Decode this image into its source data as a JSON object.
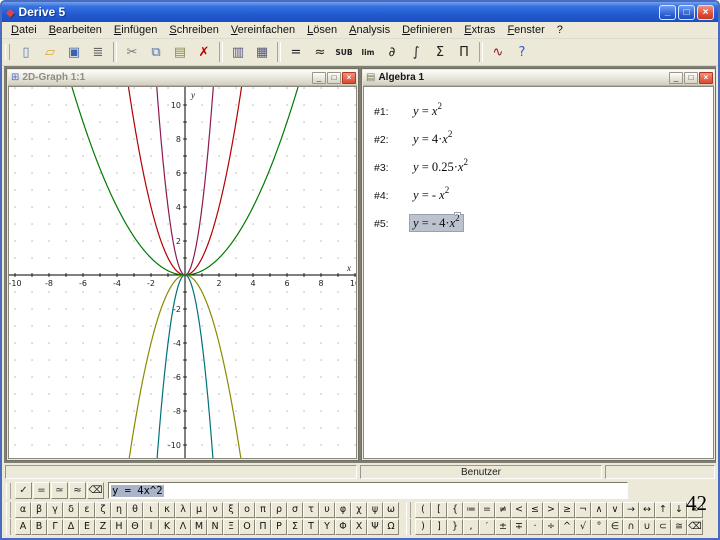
{
  "window": {
    "title": "Derive 5",
    "controls": {
      "minimize": "_",
      "maximize": "□",
      "close": "×"
    }
  },
  "menu": {
    "items": [
      "Datei",
      "Bearbeiten",
      "Einfügen",
      "Schreiben",
      "Vereinfachen",
      "Lösen",
      "Analysis",
      "Definieren",
      "Extras",
      "Fenster",
      "?"
    ]
  },
  "toolbar": {
    "items": [
      {
        "name": "new",
        "glyph": "▯",
        "color": "#5b7db8"
      },
      {
        "name": "open",
        "glyph": "▱",
        "color": "#d9a441"
      },
      {
        "name": "save",
        "glyph": "▣",
        "color": "#3a62b0"
      },
      {
        "name": "print",
        "glyph": "≣",
        "color": "#666666"
      },
      {
        "sep": true
      },
      {
        "name": "remove",
        "glyph": "✂",
        "color": "#777777"
      },
      {
        "name": "copy",
        "glyph": "⧉",
        "color": "#4a6fb0"
      },
      {
        "name": "paste",
        "glyph": "▤",
        "color": "#8a8a5a"
      },
      {
        "name": "delete",
        "glyph": "✗",
        "color": "#c00000"
      },
      {
        "sep": true
      },
      {
        "name": "author-vector",
        "glyph": "▥",
        "color": "#55557f"
      },
      {
        "name": "author-matrix",
        "glyph": "▦",
        "color": "#55557f"
      },
      {
        "sep": true
      },
      {
        "name": "simplify",
        "glyph": "=",
        "color": "#222222"
      },
      {
        "name": "approximate",
        "glyph": "≈",
        "color": "#222222"
      },
      {
        "name": "substitute",
        "glyph": "SUB",
        "small": true,
        "color": "#222222"
      },
      {
        "name": "limit",
        "glyph": "lim",
        "small": true,
        "color": "#222222"
      },
      {
        "name": "differentiate",
        "glyph": "∂",
        "color": "#222222"
      },
      {
        "name": "integrate",
        "glyph": "∫",
        "color": "#222222"
      },
      {
        "name": "sum",
        "glyph": "Σ",
        "color": "#222222"
      },
      {
        "name": "product",
        "glyph": "Π",
        "color": "#222222"
      },
      {
        "sep": true
      },
      {
        "name": "plot-2d",
        "glyph": "∿",
        "color": "#8b1a1a"
      },
      {
        "name": "help",
        "glyph": "?",
        "color": "#2a5fd0"
      }
    ]
  },
  "graph_window": {
    "title": "2D-Graph 1:1",
    "icon": "⊞",
    "axes": {
      "xmin": -10,
      "xmax": 10,
      "ymin": -10,
      "ymax": 10,
      "x_label": "x",
      "y_label": "y",
      "tick_step": 1,
      "label_step": 2
    },
    "curves": [
      {
        "equation": "y = x^2",
        "a": 1,
        "color": "#b40000"
      },
      {
        "equation": "y = 4·x^2",
        "a": 4,
        "color": "#8b1a4f"
      },
      {
        "equation": "y = 0.25·x^2",
        "a": 0.25,
        "color": "#007a00"
      },
      {
        "equation": "y = -x^2",
        "a": -1,
        "color": "#8a8a00"
      },
      {
        "equation": "y = -4·x^2",
        "a": -4,
        "color": "#00707a"
      }
    ]
  },
  "algebra_window": {
    "title": "Algebra 1",
    "icon": "▤",
    "rows": [
      {
        "label": "#1:",
        "selected": false,
        "parts": [
          {
            "t": "y",
            "it": true
          },
          {
            "t": " = "
          },
          {
            "t": "x",
            "it": true
          },
          {
            "t": "2",
            "sup": true
          }
        ]
      },
      {
        "label": "#2:",
        "selected": false,
        "parts": [
          {
            "t": "y",
            "it": true
          },
          {
            "t": " = 4·"
          },
          {
            "t": "x",
            "it": true
          },
          {
            "t": "2",
            "sup": true
          }
        ]
      },
      {
        "label": "#3:",
        "selected": false,
        "parts": [
          {
            "t": "y",
            "it": true
          },
          {
            "t": " = 0.25·"
          },
          {
            "t": "x",
            "it": true
          },
          {
            "t": "2",
            "sup": true
          }
        ]
      },
      {
        "label": "#4:",
        "selected": false,
        "parts": [
          {
            "t": "y",
            "it": true
          },
          {
            "t": " = - "
          },
          {
            "t": "x",
            "it": true
          },
          {
            "t": "2",
            "sup": true
          }
        ]
      },
      {
        "label": "#5:",
        "selected": true,
        "parts": [
          {
            "t": "y",
            "it": true
          },
          {
            "t": " = - 4·"
          },
          {
            "t": "x",
            "it": true
          },
          {
            "t": "2",
            "sup": true
          }
        ]
      }
    ]
  },
  "status_bar": {
    "user_label": "Benutzer"
  },
  "entry": {
    "buttons": [
      {
        "name": "confirm",
        "glyph": "✓"
      },
      {
        "name": "simplify",
        "glyph": "="
      },
      {
        "name": "equivalence",
        "glyph": "≃"
      },
      {
        "name": "approximate",
        "glyph": "≈"
      },
      {
        "name": "backspace",
        "glyph": "⌫"
      }
    ],
    "value": "y = 4x^2"
  },
  "symbol_bars": {
    "greek_lower": [
      "α",
      "β",
      "γ",
      "δ",
      "ε",
      "ζ",
      "η",
      "θ",
      "ι",
      "κ",
      "λ",
      "μ",
      "ν",
      "ξ",
      "ο",
      "π",
      "ρ",
      "σ",
      "τ",
      "υ",
      "φ",
      "χ",
      "ψ",
      "ω"
    ],
    "greek_upper": [
      "Α",
      "Β",
      "Γ",
      "Δ",
      "Ε",
      "Ζ",
      "Η",
      "Θ",
      "Ι",
      "Κ",
      "Λ",
      "Μ",
      "Ν",
      "Ξ",
      "Ο",
      "Π",
      "Ρ",
      "Σ",
      "Τ",
      "Υ",
      "Φ",
      "Χ",
      "Ψ",
      "Ω"
    ],
    "math_row1": [
      "(",
      "[",
      "{",
      "≔",
      "=",
      "≠",
      "<",
      "≤",
      ">",
      "≥",
      "¬",
      "∧",
      "∨",
      "→",
      "↔",
      "↑",
      "↓",
      "∞"
    ],
    "math_row2": [
      ")",
      "]",
      "}",
      ",",
      "′",
      "±",
      "∓",
      "·",
      "÷",
      "^",
      "√",
      "°",
      "∈",
      "∩",
      "∪",
      "⊂",
      "≅",
      "⌫"
    ]
  },
  "slide_number": "42",
  "colors": {
    "titlebar_blue": "#225bd0",
    "close_red": "#dd5038",
    "selection": "#bcc3cf",
    "window_face": "#ece9d8"
  }
}
